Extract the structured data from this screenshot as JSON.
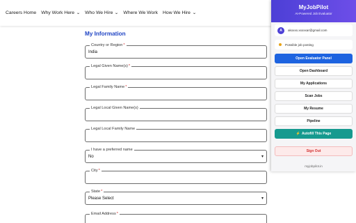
{
  "nav": {
    "items": [
      {
        "label": "Careers Home",
        "has_dropdown": false
      },
      {
        "label": "Why Work Here",
        "has_dropdown": true
      },
      {
        "label": "Who We Hire",
        "has_dropdown": true
      },
      {
        "label": "Where We Work",
        "has_dropdown": false
      },
      {
        "label": "How We Hire",
        "has_dropdown": true
      }
    ]
  },
  "form": {
    "section_title": "My Information",
    "fields": [
      {
        "label": "Country or Region",
        "required": true,
        "value": "India",
        "type": "text"
      },
      {
        "label": "Legal Given Name(s)",
        "required": true,
        "value": "",
        "type": "text"
      },
      {
        "label": "Legal Family Name",
        "required": true,
        "value": "",
        "type": "text"
      },
      {
        "label": "Legal Local Given Name(s)",
        "required": false,
        "value": "",
        "type": "text"
      },
      {
        "label": "Legal Local Family Name",
        "required": false,
        "value": "",
        "type": "text"
      },
      {
        "label": "I have a preferred name",
        "required": false,
        "value": "No",
        "type": "select"
      },
      {
        "label": "City",
        "required": true,
        "value": "",
        "type": "text"
      },
      {
        "label": "State",
        "required": true,
        "value": "Please Select",
        "type": "select"
      },
      {
        "label": "Email Address",
        "required": true,
        "value": "",
        "type": "text"
      }
    ]
  },
  "extension": {
    "title": "MyJobPilot",
    "subtitle": "AI-Powered Job Evaluator",
    "user": {
      "initial": "A",
      "email": "akxxxx.xxxxxar@gmail.com"
    },
    "status": {
      "text": "Possible job posting",
      "color": "#e8a317"
    },
    "buttons": {
      "open_evaluator": "Open Evaluator Panel",
      "open_dashboard": "Open Dashboard",
      "my_applications": "My Applications",
      "scan_jobs": "Scan Jobs",
      "my_resume": "My Resume",
      "pipeline": "Pipeline",
      "autofill": "Autofill This Page",
      "autofill_icon": "⚡",
      "sign_out": "Sign Out"
    },
    "footer": "myjobpilot.in"
  },
  "colors": {
    "accent_blue": "#1d63e0",
    "header_purple": "#4c3fd6",
    "teal": "#169a8f",
    "danger_red": "#d32f2f",
    "section_title_blue": "#1f44c4"
  }
}
